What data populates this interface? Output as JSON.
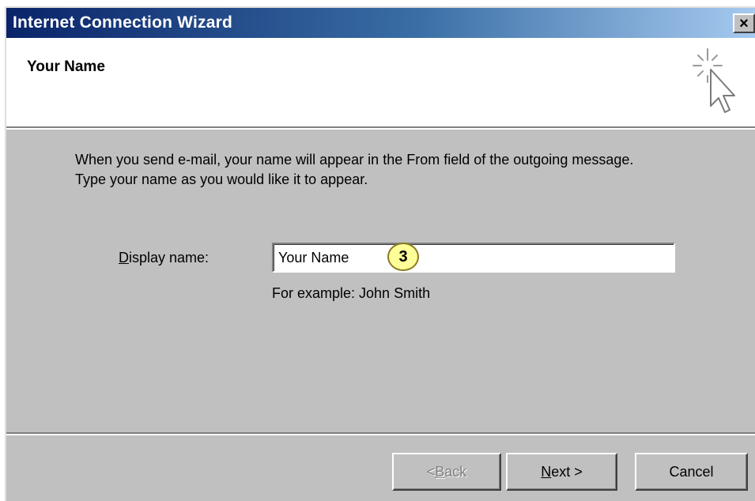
{
  "window": {
    "title": "Internet Connection Wizard",
    "close_label": "×"
  },
  "header": {
    "title": "Your Name",
    "icon": "wizard-cursor-sparkle-icon"
  },
  "content": {
    "description_line1": "When you send e-mail, your name will appear in the From field of the outgoing message.",
    "description_line2": "Type your name as you would like it to appear.",
    "display_name_label_mnemonic": "D",
    "display_name_label_rest": "isplay name:",
    "display_name_value": "Your Name",
    "example_hint": "For example: John Smith",
    "callout_number": "3"
  },
  "buttons": {
    "back_prefix": "< ",
    "back_mnemonic": "B",
    "back_rest": "ack",
    "back_enabled": false,
    "next_mnemonic": "N",
    "next_rest": "ext >",
    "cancel": "Cancel"
  },
  "colors": {
    "titlebar_start": "#0a246a",
    "titlebar_end": "#a6caf0",
    "dialog_face": "#c0c0c0",
    "callout_fill": "#ffff99"
  }
}
